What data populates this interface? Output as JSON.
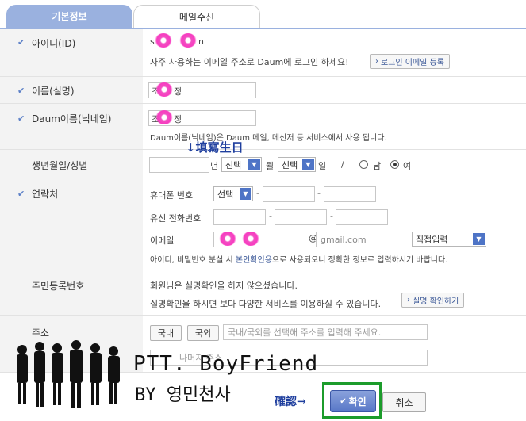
{
  "tabs": {
    "active": "기본정보",
    "inactive": "메일수신"
  },
  "id_row": {
    "label": "아이디(ID)",
    "value_visible": "s",
    "value_tail": "n",
    "hint": "자주 사용하는 이메일 주소로 Daum에 로그인 하세요!",
    "login_email_button": "로그인 이메일 등록"
  },
  "name_row": {
    "label": "이름(실명)",
    "value_visible": "조",
    "value_tail": "정"
  },
  "nickname_row": {
    "label": "Daum이름(닉네임)",
    "value_visible": "조",
    "value_tail": "정",
    "hint": "Daum이름(닉네임)은 Daum 메일, 메신저 등 서비스에서 사용 됩니다."
  },
  "birth_row": {
    "label": "생년월일/성별",
    "year_suffix": "년",
    "month_select": "선택",
    "month_suffix": "월",
    "day_select": "선택",
    "day_suffix": "일",
    "separator": "/",
    "gender_male": "남",
    "gender_female": "여",
    "annotation": "↓填寫生日"
  },
  "contact_row": {
    "label": "연락처",
    "mobile_label": "휴대폰 번호",
    "mobile_select": "선택",
    "dash": "-",
    "landline_label": "유선 전화번호",
    "email_label": "이메일",
    "at": "@",
    "email_domain": "gmail.com",
    "domain_select": "직접입력",
    "hint_prefix": "아이디, 비밀번호 분실 시 ",
    "hint_link": "본인확인용",
    "hint_suffix": "으로 사용되오니 정확한 정보로 입력하시기 바랍니다."
  },
  "rrn_row": {
    "label": "주민등록번호",
    "line1": "회원님은 실명확인을 하지 않으셨습니다.",
    "line2": "실명확인을 하시면 보다 다양한 서비스를 이용하실 수 있습니다.",
    "verify_button": "실명 확인하기"
  },
  "address_row": {
    "label": "주소",
    "domestic_button": "국내",
    "overseas_button": "국외",
    "address_placeholder": "국내/국외를 선택해 주소를 입력해 주세요.",
    "detail_placeholder": "나머지 주소"
  },
  "footer": {
    "confirm_annotation": "確認→",
    "confirm_button": "확인",
    "cancel_button": "취소"
  },
  "watermark": {
    "line1": "PTT. BoyFriend",
    "line2": "BY 영민천사"
  },
  "colors": {
    "accent": "#9ab1df",
    "button_blue": "#5877c7",
    "highlight_frame": "#1c9c2b",
    "annotation": "#1f3f9e"
  }
}
